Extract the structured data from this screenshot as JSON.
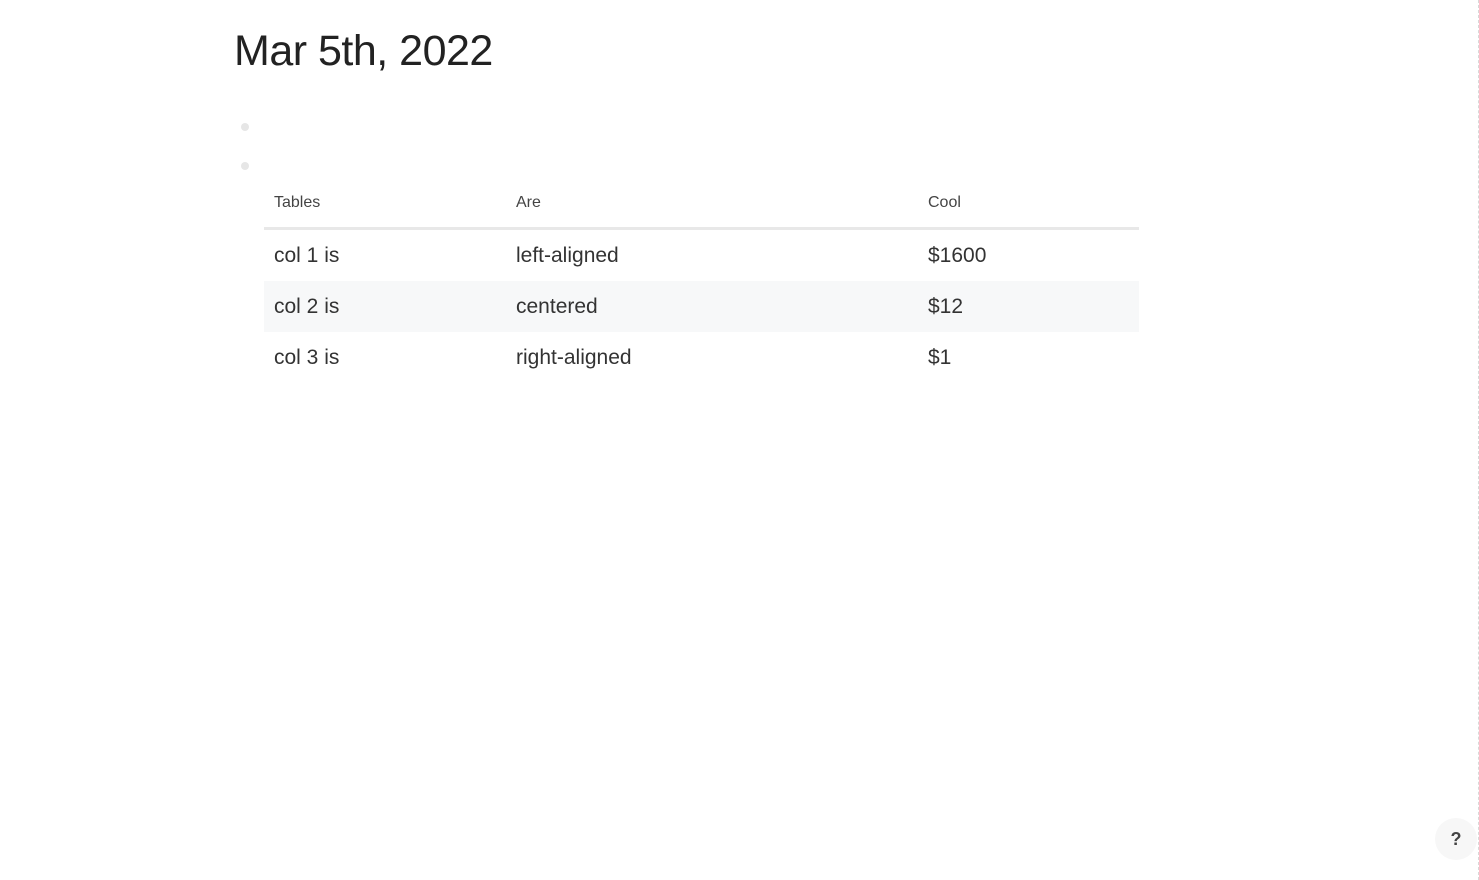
{
  "page": {
    "title": "Mar 5th, 2022"
  },
  "table": {
    "headers": [
      "Tables",
      "Are",
      "Cool"
    ],
    "rows": [
      [
        "col 1 is",
        "left-aligned",
        "$1600"
      ],
      [
        "col 2 is",
        "centered",
        "$12"
      ],
      [
        "col 3 is",
        "right-aligned",
        "$1"
      ]
    ]
  },
  "help": {
    "label": "?"
  },
  "colors": {
    "stripe": "#f7f8f9",
    "header_rule": "#e8e8e8",
    "bullet": "#e6e6e6"
  }
}
